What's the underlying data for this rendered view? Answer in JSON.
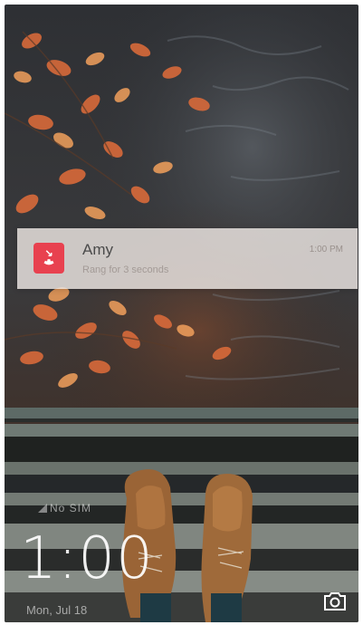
{
  "notification": {
    "title": "Amy",
    "subtitle": "Rang for 3 seconds",
    "time": "1:00 PM",
    "icon": "missed-call-icon",
    "icon_color": "#e8414f"
  },
  "lockscreen": {
    "status": "No SIM",
    "clock": "1:00",
    "date": "Mon, Jul 18",
    "camera_icon": "camera-icon"
  }
}
